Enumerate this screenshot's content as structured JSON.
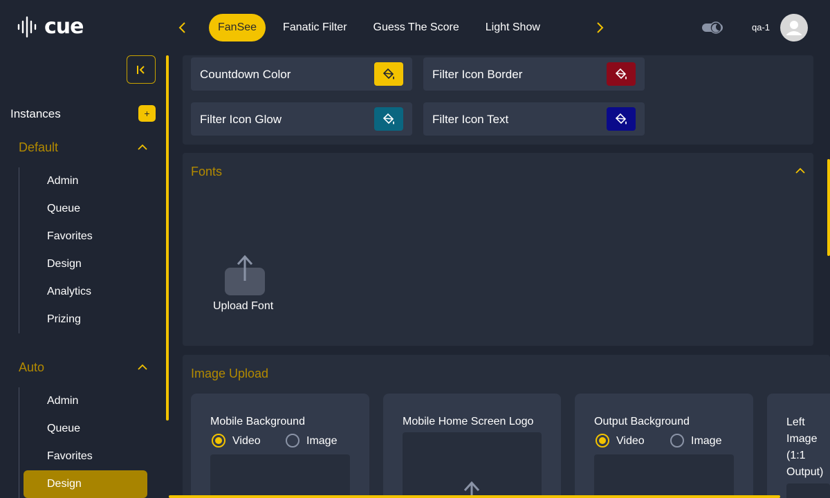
{
  "app": {
    "logo_text": "cue"
  },
  "header": {
    "tabs": [
      {
        "label": "FanSee",
        "active": true
      },
      {
        "label": "Fanatic Filter",
        "active": false
      },
      {
        "label": "Guess The Score",
        "active": false
      },
      {
        "label": "Light Show",
        "active": false
      }
    ],
    "user_name": "qa-1",
    "theme_toggle_icon": "moon-icon"
  },
  "sidebar": {
    "instances_label": "Instances",
    "add_label": "+",
    "groups": [
      {
        "title": "Default",
        "items": [
          "Admin",
          "Queue",
          "Favorites",
          "Design",
          "Analytics",
          "Prizing"
        ]
      },
      {
        "title": "Auto",
        "items": [
          "Admin",
          "Queue",
          "Favorites",
          "Design"
        ],
        "active_item": "Design"
      }
    ]
  },
  "colors": {
    "rows": [
      {
        "label": "Countdown Color",
        "color": "#f3c300"
      },
      {
        "label": "Filter Icon Border",
        "color": "#8b0a1a"
      },
      {
        "label": "Filter Icon Glow",
        "color": "#0a6680"
      },
      {
        "label": "Filter Icon Text",
        "color": "#0a0a8a"
      }
    ]
  },
  "fonts": {
    "title": "Fonts",
    "upload_label": "Upload Font"
  },
  "image_upload": {
    "title": "Image Upload",
    "cards": [
      {
        "title": "Mobile Background",
        "options": [
          "Video",
          "Image"
        ],
        "selected": "Video"
      },
      {
        "title": "Mobile Home Screen Logo"
      },
      {
        "title": "Output Background",
        "options": [
          "Video",
          "Image"
        ],
        "selected": "Video"
      },
      {
        "title_lines": [
          "Left",
          "Image",
          "(1:1",
          "Output)"
        ]
      }
    ]
  }
}
